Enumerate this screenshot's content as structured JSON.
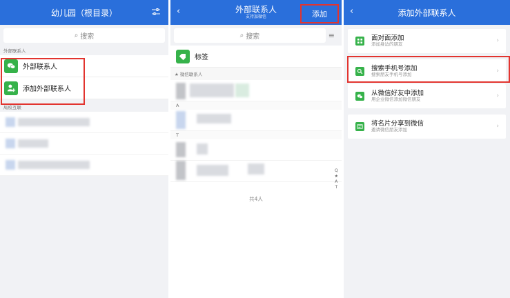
{
  "screen1": {
    "title": "幼儿园（根目录）",
    "search_placeholder": "搜索",
    "section_external": "外部联系人",
    "items": [
      {
        "label": "外部联系人",
        "icon": "wechat-icon"
      },
      {
        "label": "添加外部联系人",
        "icon": "add-user-icon"
      }
    ],
    "section_partner": "局校互联"
  },
  "screen2": {
    "title": "外部联系人",
    "subtitle": "支持加微信",
    "add_label": "添加",
    "search_placeholder": "搜索",
    "tag_label": "标签",
    "wechat_header": "★ 微信联系人",
    "letters": [
      "A",
      "T"
    ],
    "index": [
      "Q",
      "★",
      "A",
      "T"
    ],
    "count_text": "共4人"
  },
  "screen3": {
    "title": "添加外部联系人",
    "options": [
      {
        "title": "面对面添加",
        "desc": "添加身边的朋友",
        "icon": "qr-icon"
      },
      {
        "title": "搜索手机号添加",
        "desc": "搜索朋友手机号添加",
        "icon": "search-icon"
      },
      {
        "title": "从微信好友中添加",
        "desc": "用企业微信添加微信朋友",
        "icon": "wechat-icon"
      },
      {
        "title": "将名片分享到微信",
        "desc": "邀请微信朋友添加",
        "icon": "card-icon"
      }
    ]
  },
  "colors": {
    "header": "#2a6fdb",
    "accent_green": "#36b24a",
    "highlight": "#e2342f"
  }
}
